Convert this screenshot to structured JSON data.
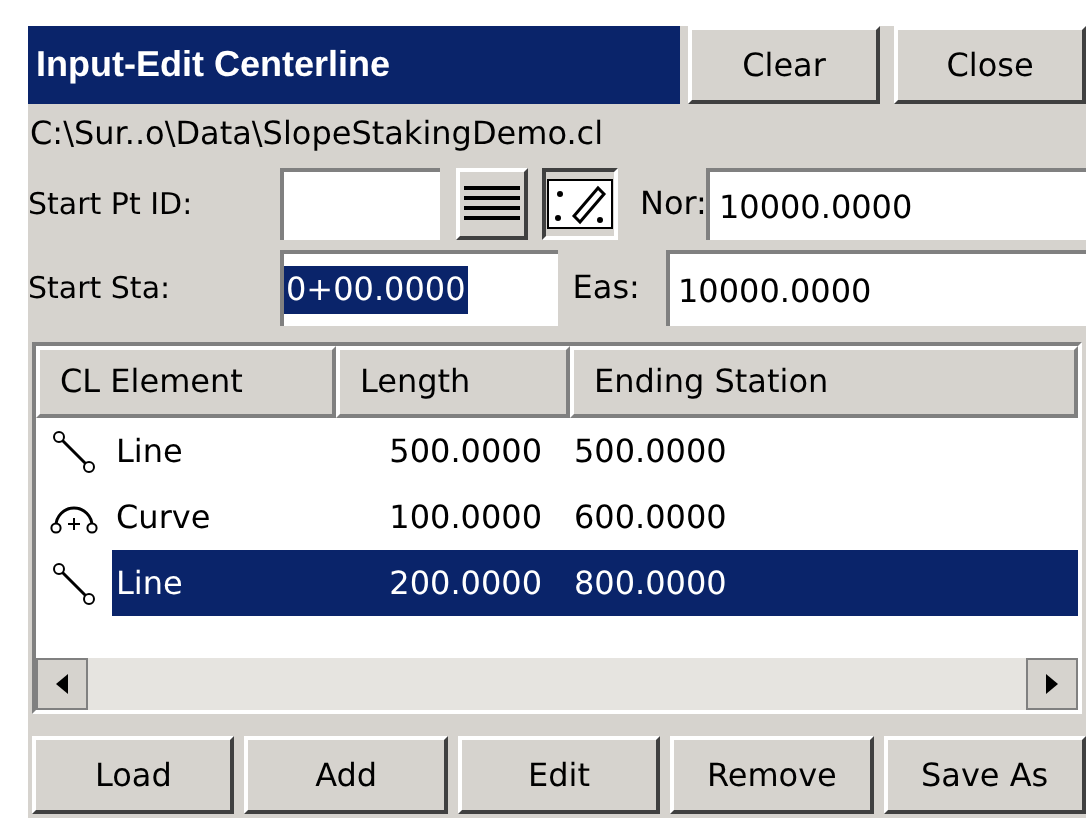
{
  "window": {
    "title": "Input-Edit Centerline"
  },
  "header_buttons": [
    "Clear",
    "Close"
  ],
  "file_path": "C:\\Sur..o\\Data\\SlopeStakingDemo.cl",
  "start_pt_id": {
    "label": "Start Pt ID:"
  },
  "northing": {
    "label": "Nor:",
    "value": "10000.0000"
  },
  "start_sta": {
    "label": "Start Sta:",
    "value": "0+00.0000",
    "text_selected": true
  },
  "easting": {
    "label": "Eas:",
    "value": "10000.0000"
  },
  "table": {
    "columns": [
      "CL Element",
      "Length",
      "Ending Station"
    ],
    "rows": [
      {
        "kind": "line",
        "cells": [
          "Line",
          "500.0000",
          "500.0000"
        ],
        "selected": false
      },
      {
        "kind": "curve",
        "cells": [
          "Curve",
          "100.0000",
          "600.0000"
        ],
        "selected": false
      },
      {
        "kind": "line",
        "cells": [
          "Line",
          "200.0000",
          "800.0000"
        ],
        "selected": true
      }
    ]
  },
  "buttons": [
    "Load",
    "Add",
    "Edit",
    "Remove",
    "Save As"
  ]
}
